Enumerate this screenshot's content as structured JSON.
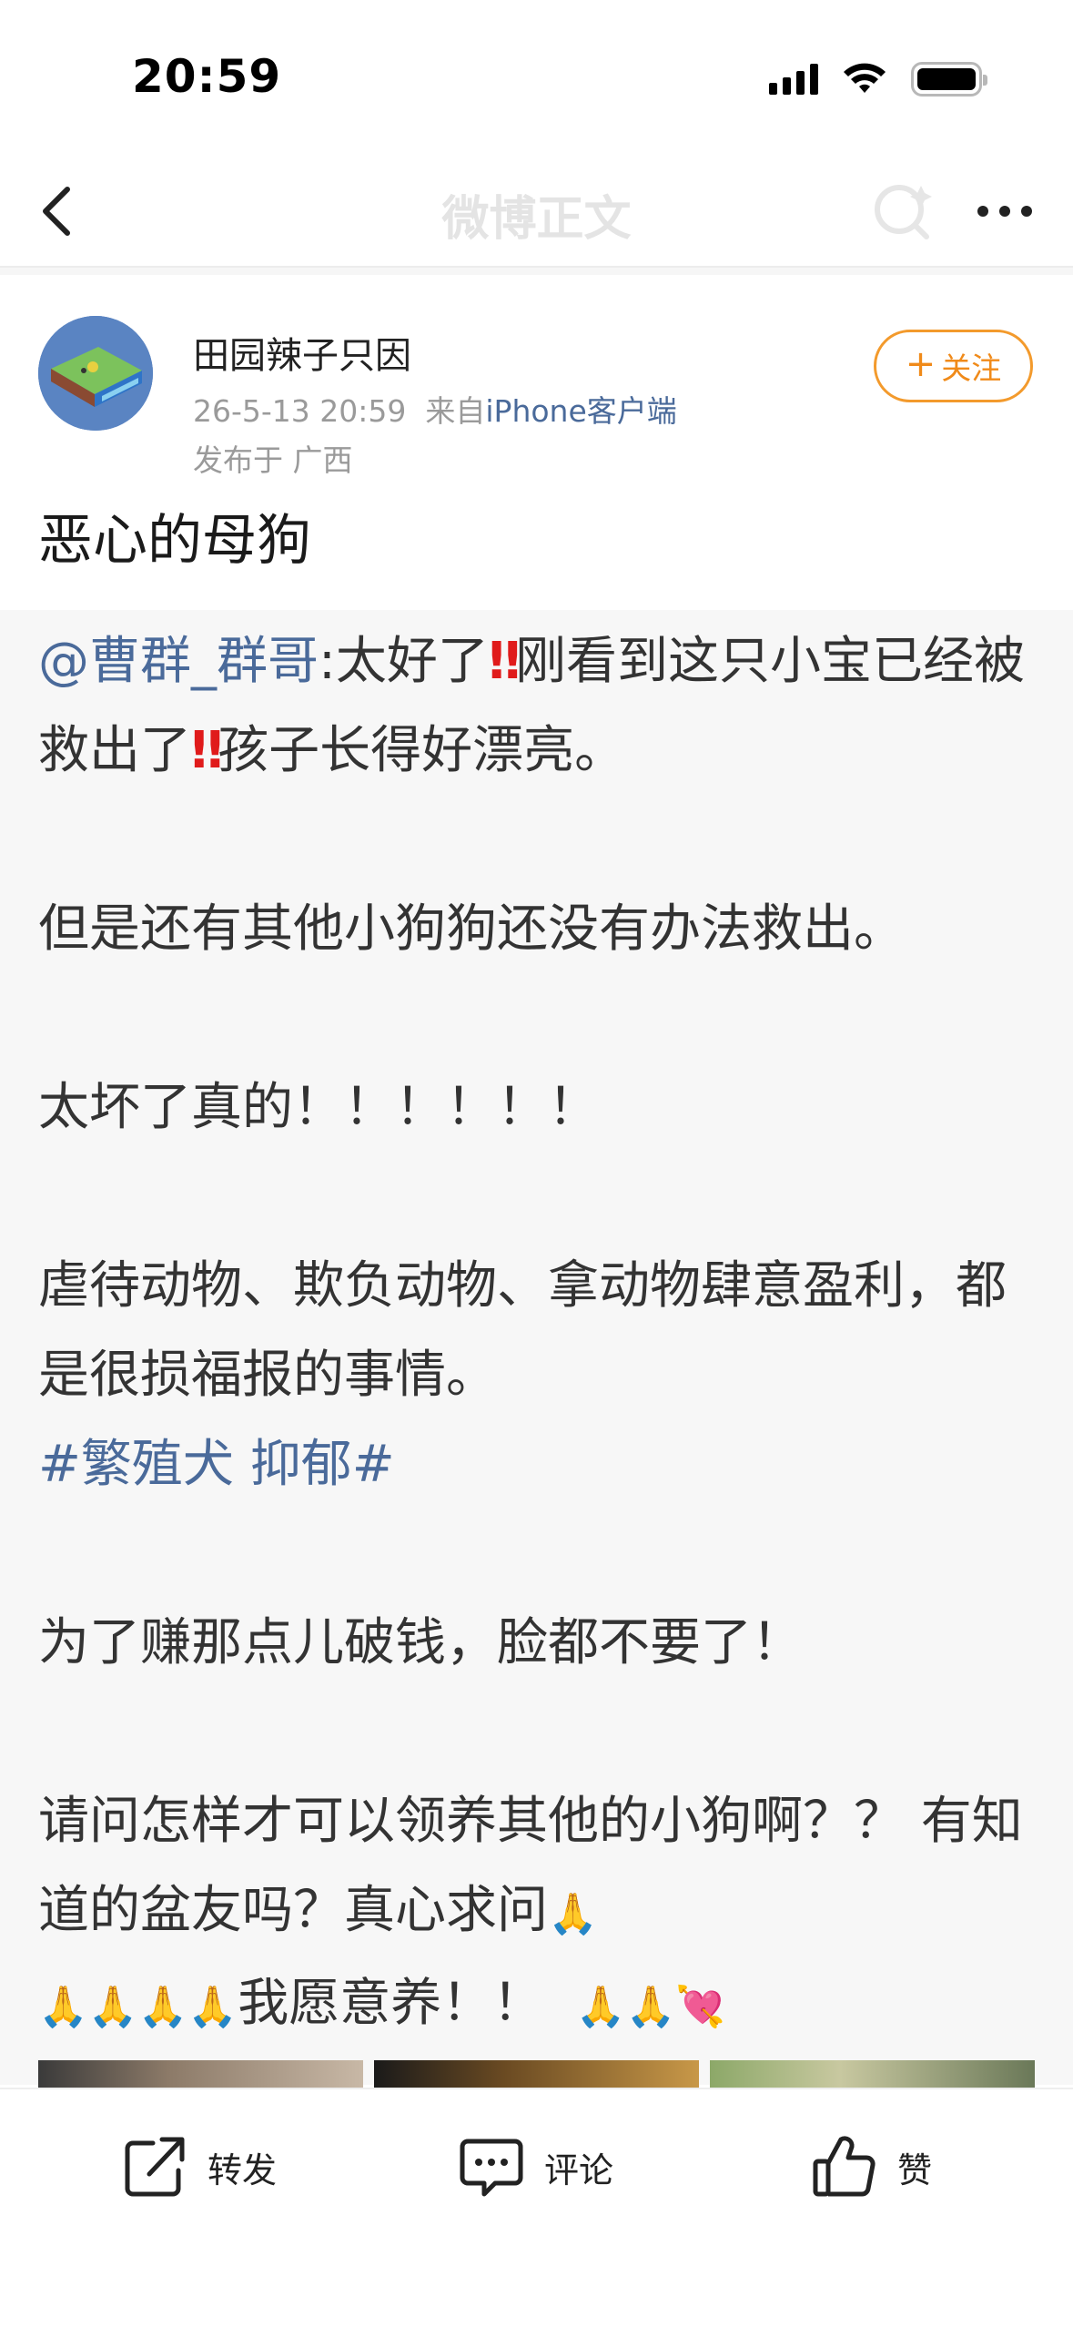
{
  "status_bar": {
    "time": "20:59",
    "icons": [
      "signal-icon",
      "wifi-icon",
      "battery-icon"
    ]
  },
  "nav": {
    "title": "微博正文",
    "back_icon": "chevron-left-icon",
    "search_icon": "search-icon",
    "more_icon": "more-horizontal-icon"
  },
  "post": {
    "author": "田园辣子只因",
    "timestamp": "26-5-13 20:59",
    "source_prefix": "来自",
    "source": "iPhone客户端",
    "location": "发布于 广西",
    "follow_label": "关注",
    "text": "恶心的母狗"
  },
  "repost": {
    "mention": "@曹群_群哥",
    "p1_a": ":太好了",
    "p1_b": "刚看到这只小宝已经被救出了",
    "p1_c": "孩子长得好漂亮。",
    "p2": "但是还有其他小狗狗还没有办法救出。",
    "p3": "太坏了真的！！！！！！",
    "p4": "虐待动物、欺负动物、拿动物肆意盈利，都是很损福报的事情。",
    "hashtag": "#繁殖犬 抑郁#",
    "p5": "为了赚那点儿破钱，脸都不要了！",
    "p6_a": "请问怎样才可以领养其他的小狗啊？？ 有知道的盆友吗？真心求问",
    "p6_b": "我愿意养！！",
    "emoji_bang": "‼",
    "emoji_pray": "🙏",
    "emoji_heart": "💘"
  },
  "toolbar": {
    "repost_label": "转发",
    "comment_label": "评论",
    "like_label": "赞"
  },
  "colors": {
    "link": "#4a6a9a",
    "follow": "#f08a19",
    "body_bg": "#f7f7f7"
  }
}
